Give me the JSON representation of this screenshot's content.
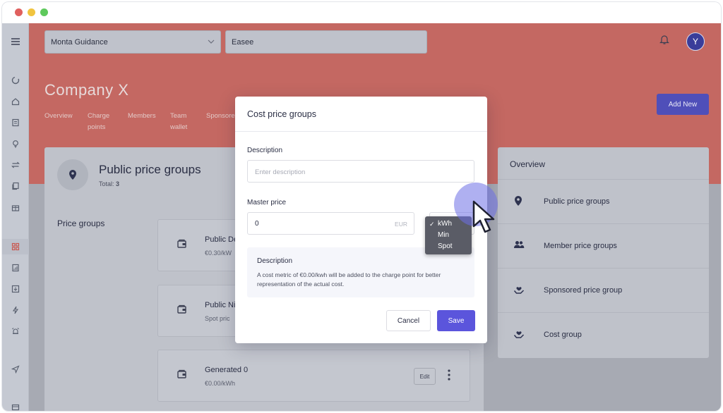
{
  "window": {
    "traffic_lights": [
      "#e0605e",
      "#f1c43f",
      "#5ec95c"
    ]
  },
  "sidebar": {
    "icons": [
      "menu-icon",
      "loader-icon",
      "home-icon",
      "document-icon",
      "lightbulb-icon",
      "swap-icon",
      "files-icon",
      "gift-icon",
      "grid-icon",
      "report-icon",
      "download-icon",
      "bolt-icon",
      "alarm-icon",
      "send-icon",
      "card-icon"
    ],
    "active": "grid-icon"
  },
  "topbar": {
    "selector_1": "Monta Guidance",
    "selector_2": "Easee",
    "avatar_initial": "Y"
  },
  "header": {
    "company_name": "Company X",
    "tabs": [
      {
        "label": "Overview"
      },
      {
        "label": "Charge points"
      },
      {
        "label": "Members"
      },
      {
        "label": "Team wallet"
      },
      {
        "label": "Sponsored"
      }
    ],
    "add_new_label": "Add New"
  },
  "public_price_groups": {
    "title": "Public price groups",
    "total_label": "Total:",
    "total_value": "3",
    "section_label": "Price groups",
    "items": [
      {
        "name": "Public De",
        "sub": "€0.30/kW"
      },
      {
        "name": "Public Ni",
        "sub": "Spot pric"
      },
      {
        "name": "Generated 0",
        "sub": "€0.00/kWh",
        "edit_label": "Edit"
      }
    ]
  },
  "overview": {
    "title": "Overview",
    "items": [
      {
        "label": "Public price groups",
        "icon": "pin-icon"
      },
      {
        "label": "Member price groups",
        "icon": "people-icon"
      },
      {
        "label": "Sponsored price group",
        "icon": "hand-heart-icon"
      },
      {
        "label": "Cost group",
        "icon": "hand-heart-icon"
      }
    ]
  },
  "modal": {
    "title": "Cost price groups",
    "description_label": "Description",
    "description_placeholder": "Enter description",
    "master_price_label": "Master price",
    "master_price_value": "0",
    "currency": "EUR",
    "unit_options": [
      "kWh",
      "Min",
      "Spot"
    ],
    "unit_selected": "kWh",
    "info_title": "Description",
    "info_text": "A cost metric of €0.00/kwh will be added to the charge point for better representation of the actual cost.",
    "cancel_label": "Cancel",
    "save_label": "Save"
  },
  "colors": {
    "header_red": "#c46862",
    "primary": "#5b55dc",
    "avatar_bg": "#3a3d9a"
  }
}
